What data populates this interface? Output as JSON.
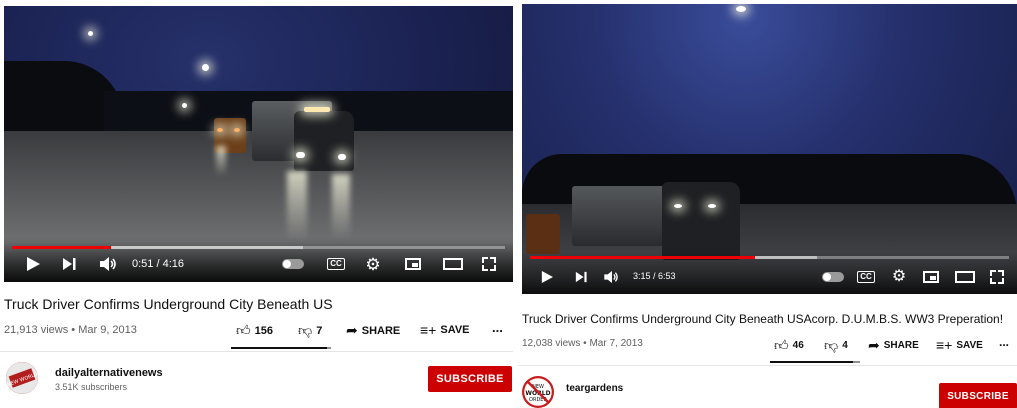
{
  "left": {
    "player": {
      "current_time": "0:51",
      "separator": " / ",
      "duration": "4:16",
      "progress": 0.2,
      "buffered": 0.59
    },
    "title": "Truck Driver Confirms Underground City Beneath US",
    "views": "21,913 views",
    "dot": "•",
    "date": "Mar 9, 2013",
    "likes": "156",
    "dislikes": "7",
    "share_label": "SHARE",
    "save_label": "SAVE",
    "more": "...",
    "like_ratio": 0.96,
    "channel": {
      "name": "dailyalternativenews",
      "subscribers": "3.51K subscribers",
      "avatar_text": "NEW WORLD"
    },
    "subscribe_label": "SUBSCRIBE"
  },
  "right": {
    "player": {
      "current_time": "3:15",
      "separator": " / ",
      "duration": "6:53",
      "progress": 0.47,
      "buffered": 0.6
    },
    "title": "Truck Driver Confirms Underground City Beneath USAcorp. D.U.M.B.S. WW3 Preperation!",
    "views": "12,038 views",
    "dot": "•",
    "date": "Mar 7, 2013",
    "likes": "46",
    "dislikes": "4",
    "share_label": "SHARE",
    "save_label": "SAVE",
    "more": "...",
    "like_ratio": 0.92,
    "channel": {
      "name": "teargardens",
      "avatar_text": "NEW WORLD ORDER"
    },
    "subscribe_label": "SUBSCRIBE"
  },
  "icons": {
    "play": "play-icon",
    "next": "next-icon",
    "volume": "volume-icon",
    "autoplay": "autoplay-toggle-icon",
    "captions": "captions-icon",
    "settings": "gear-icon",
    "miniplayer": "miniplayer-icon",
    "theater": "theater-mode-icon",
    "fullscreen": "fullscreen-icon",
    "like": "thumbs-up-icon",
    "dislike": "thumbs-down-icon",
    "share": "share-icon",
    "save": "save-playlist-icon"
  },
  "colors": {
    "progress": "#ff0000",
    "subscribe": "#cc0000",
    "text": "#0f0f0f",
    "muted": "#606060"
  }
}
